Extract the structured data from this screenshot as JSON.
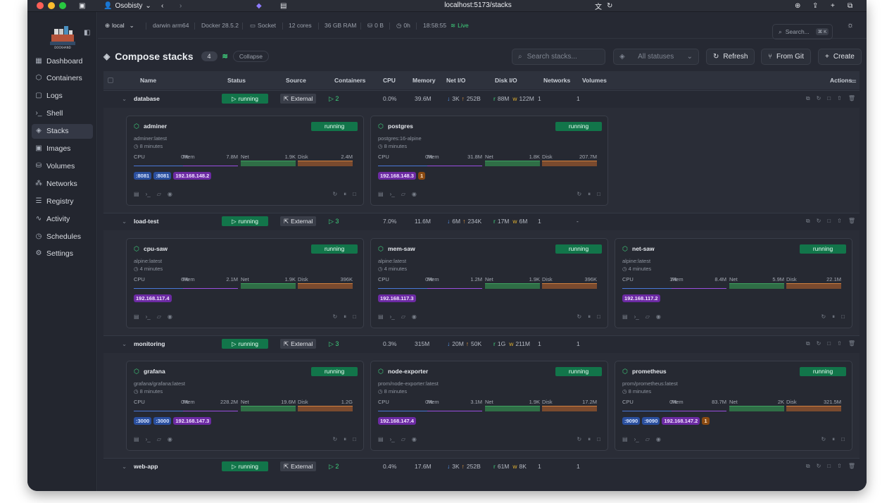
{
  "browser": {
    "profile_label": "Osobisty",
    "url": "localhost:5173/stacks"
  },
  "sidebar": {
    "logo_text": "DOCKHAND",
    "items": [
      {
        "label": "Dashboard",
        "icon": "dashboard-icon"
      },
      {
        "label": "Containers",
        "icon": "box-icon"
      },
      {
        "label": "Logs",
        "icon": "file-icon"
      },
      {
        "label": "Shell",
        "icon": "terminal-icon"
      },
      {
        "label": "Stacks",
        "icon": "layers-icon"
      },
      {
        "label": "Images",
        "icon": "image-icon"
      },
      {
        "label": "Volumes",
        "icon": "disk-icon"
      },
      {
        "label": "Networks",
        "icon": "network-icon"
      },
      {
        "label": "Registry",
        "icon": "registry-icon"
      },
      {
        "label": "Activity",
        "icon": "activity-icon"
      },
      {
        "label": "Schedules",
        "icon": "clock-icon"
      },
      {
        "label": "Settings",
        "icon": "gear-icon"
      }
    ]
  },
  "statusbar": {
    "env": "local",
    "platform": "darwin arm64",
    "docker": "Docker 28.5.2",
    "connection": "Socket",
    "cores": "12 cores",
    "ram": "36 GB RAM",
    "disk": "0 B",
    "uptime": "0h",
    "time": "18:58:55",
    "live": "Live",
    "search_placeholder": "Search...",
    "shortcut": "⌘ K"
  },
  "toolbar": {
    "title": "Compose stacks",
    "count": "4",
    "collapse": "Collapse",
    "search_placeholder": "Search stacks...",
    "status_filter": "All statuses",
    "refresh": "Refresh",
    "from_git": "From Git",
    "create": "Create"
  },
  "columns": [
    "Name",
    "Status",
    "Source",
    "Containers",
    "CPU",
    "Memory",
    "Net I/O",
    "Disk I/O",
    "Networks",
    "Volumes",
    "Actions"
  ],
  "stacks": [
    {
      "name": "database",
      "status": "running",
      "source": "External",
      "containers": "2",
      "cpu": "0.0%",
      "memory": "39.6M",
      "net_in": "3K",
      "net_out": "252B",
      "disk_r": "88M",
      "disk_w": "122M",
      "networks": "1",
      "volumes": "1",
      "cards": [
        {
          "name": "adminer",
          "state": "running",
          "image": "adminer:latest",
          "age": "8 minutes",
          "cpu": "0%",
          "mem": "7.8M",
          "net": "1.9K",
          "disk": "2.4M",
          "chips": [
            {
              "t": ":8081",
              "k": "port"
            },
            {
              "t": ":8081",
              "k": "port"
            },
            {
              "t": "192.168.148.2",
              "k": "ip"
            }
          ]
        },
        {
          "name": "postgres",
          "state": "running",
          "image": "postgres:16-alpine",
          "age": "8 minutes",
          "cpu": "0%",
          "mem": "31.8M",
          "net": "1.8K",
          "disk": "207.7M",
          "chips": [
            {
              "t": "192.168.148.3",
              "k": "ip"
            },
            {
              "t": "1",
              "k": "vol"
            }
          ]
        }
      ]
    },
    {
      "name": "load-test",
      "status": "running",
      "source": "External",
      "containers": "3",
      "cpu": "7.0%",
      "memory": "11.6M",
      "net_in": "6M",
      "net_out": "234K",
      "disk_r": "17M",
      "disk_w": "6M",
      "networks": "1",
      "volumes": "-",
      "cards": [
        {
          "name": "cpu-saw",
          "state": "running",
          "image": "alpine:latest",
          "age": "4 minutes",
          "cpu": "6%",
          "mem": "2.1M",
          "net": "1.9K",
          "disk": "396K",
          "chips": [
            {
              "t": "192.168.117.4",
              "k": "ip"
            }
          ]
        },
        {
          "name": "mem-saw",
          "state": "running",
          "image": "alpine:latest",
          "age": "4 minutes",
          "cpu": "0%",
          "mem": "1.2M",
          "net": "1.9K",
          "disk": "396K",
          "chips": [
            {
              "t": "192.168.117.3",
              "k": "ip"
            }
          ]
        },
        {
          "name": "net-saw",
          "state": "running",
          "image": "alpine:latest",
          "age": "4 minutes",
          "cpu": "1%",
          "mem": "8.4M",
          "net": "5.9M",
          "disk": "22.1M",
          "chips": [
            {
              "t": "192.168.117.2",
              "k": "ip"
            }
          ]
        }
      ]
    },
    {
      "name": "monitoring",
      "status": "running",
      "source": "External",
      "containers": "3",
      "cpu": "0.3%",
      "memory": "315M",
      "net_in": "20M",
      "net_out": "50K",
      "disk_r": "1G",
      "disk_w": "211M",
      "networks": "1",
      "volumes": "1",
      "cards": [
        {
          "name": "grafana",
          "state": "running",
          "image": "grafana/grafana:latest",
          "age": "8 minutes",
          "cpu": "0%",
          "mem": "228.2M",
          "net": "19.6M",
          "disk": "1.2G",
          "chips": [
            {
              "t": ":3000",
              "k": "port"
            },
            {
              "t": ":3000",
              "k": "port"
            },
            {
              "t": "192.168.147.3",
              "k": "ip"
            }
          ]
        },
        {
          "name": "node-exporter",
          "state": "running",
          "image": "prom/node-exporter:latest",
          "age": "8 minutes",
          "cpu": "0%",
          "mem": "3.1M",
          "net": "1.9K",
          "disk": "17.2M",
          "chips": [
            {
              "t": "192.168.147.4",
              "k": "ip"
            }
          ]
        },
        {
          "name": "prometheus",
          "state": "running",
          "image": "prom/prometheus:latest",
          "age": "8 minutes",
          "cpu": "0%",
          "mem": "83.7M",
          "net": "2K",
          "disk": "321.5M",
          "chips": [
            {
              "t": ":9090",
              "k": "port"
            },
            {
              "t": ":9090",
              "k": "port"
            },
            {
              "t": "192.168.147.2",
              "k": "ip"
            },
            {
              "t": "1",
              "k": "vol"
            }
          ]
        }
      ]
    },
    {
      "name": "web-app",
      "status": "running",
      "source": "External",
      "containers": "2",
      "cpu": "0.4%",
      "memory": "17.6M",
      "net_in": "3K",
      "net_out": "252B",
      "disk_r": "61M",
      "disk_w": "8K",
      "networks": "1",
      "volumes": "1",
      "cards": []
    }
  ],
  "colors": {
    "running": "#12754a",
    "port": "#2a4f9e",
    "ip": "#6c2aa3",
    "vol": "#8a4a12",
    "accent": "#3fd27d"
  }
}
